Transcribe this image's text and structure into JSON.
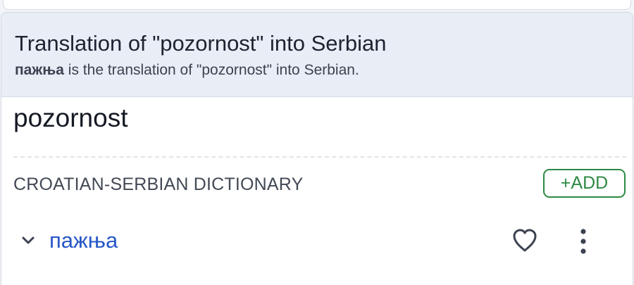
{
  "header": {
    "title": "Translation of \"pozornost\" into Serbian",
    "subtitle_term": "пажња",
    "subtitle_rest": " is the translation of \"pozornost\" into Serbian."
  },
  "entry": {
    "word": "pozornost"
  },
  "dictionary": {
    "label": "CROATIAN-SERBIAN DICTIONARY",
    "add_label": "+ADD"
  },
  "translations": [
    {
      "term": "пажња",
      "expand_icon": "chevron-down-icon",
      "favorite_icon": "heart-icon",
      "menu_icon": "more-vertical-icon"
    }
  ],
  "colors": {
    "header_bg": "#e8edf6",
    "add_green": "#2d8a43",
    "link_blue": "#2757c8"
  }
}
